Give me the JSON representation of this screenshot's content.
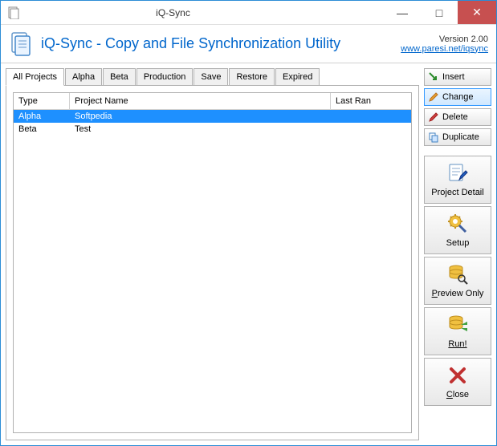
{
  "window": {
    "title": "iQ-Sync"
  },
  "header": {
    "title": "iQ-Sync - Copy and File Synchronization Utility",
    "version": "Version 2.00",
    "link": "www.paresi.net/iqsync"
  },
  "tabs": [
    "All Projects",
    "Alpha",
    "Beta",
    "Production",
    "Save",
    "Restore",
    "Expired"
  ],
  "activeTab": 0,
  "columns": {
    "type": "Type",
    "name": "Project Name",
    "lastran": "Last Ran"
  },
  "rows": [
    {
      "type": "Alpha",
      "name": "Softpedia",
      "lastran": "",
      "selected": true
    },
    {
      "type": "Beta",
      "name": "Test",
      "lastran": "",
      "selected": false
    }
  ],
  "buttons": {
    "insert": "Insert",
    "change": "Change",
    "delete": "Delete",
    "duplicate": "Duplicate",
    "projectDetail": "Project Detail",
    "setup": "Setup",
    "previewOnly": "Preview Only",
    "run": "Run!",
    "close": "Close"
  }
}
